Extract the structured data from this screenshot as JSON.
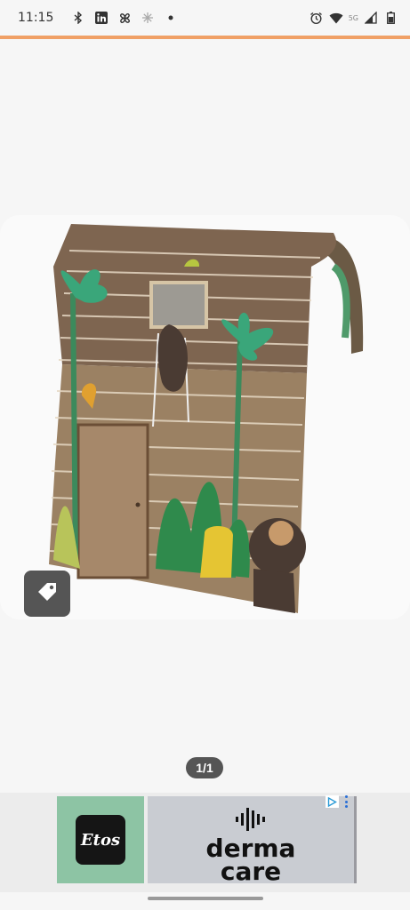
{
  "status_bar": {
    "time": "11:15",
    "network_label": "5G",
    "icons_left": [
      "bluetooth-icon",
      "linkedin-icon",
      "pinwheel-icon",
      "snowflake-icon",
      "dot-icon"
    ],
    "icons_right": [
      "alarm-icon",
      "wifi-icon",
      "signal-icon",
      "battery-icon"
    ]
  },
  "loading": {
    "progress": 1.0,
    "color": "#f0a066"
  },
  "gallery": {
    "image": "bed-tent-jungle-product-photo",
    "pager": "1/1",
    "tag_button_icon": "price-tag-icon"
  },
  "ad": {
    "left_brand": "Etos",
    "left_bg": "#8dc4a4",
    "right_line1": "derma",
    "right_line2": "care",
    "right_bg": "#c9ccd2",
    "adchoices_icon": "adchoices-icon",
    "menu_icon": "ad-menu-dots-icon"
  }
}
